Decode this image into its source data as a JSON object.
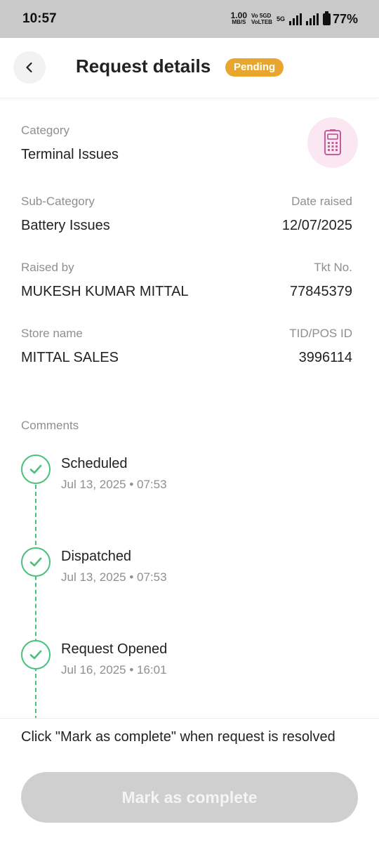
{
  "status_bar": {
    "time": "10:57",
    "net_speed_value": "1.00",
    "net_speed_unit": "MB/S",
    "volte_top": "Vo 5GD",
    "volte_bottom": "VoLTEB",
    "network_type": "5G",
    "battery": "77%"
  },
  "header": {
    "title": "Request details",
    "status": "Pending"
  },
  "details": {
    "category_label": "Category",
    "category_value": "Terminal Issues",
    "subcategory_label": "Sub-Category",
    "subcategory_value": "Battery Issues",
    "date_raised_label": "Date raised",
    "date_raised_value": "12/07/2025",
    "raised_by_label": "Raised by",
    "raised_by_value": "MUKESH KUMAR MITTAL",
    "ticket_label": "Tkt No.",
    "ticket_value": "77845379",
    "store_label": "Store name",
    "store_value": "MITTAL SALES",
    "tid_label": "TID/POS ID",
    "tid_value": "3996114"
  },
  "comments": {
    "label": "Comments",
    "items": [
      {
        "title": "Scheduled",
        "time": "Jul 13, 2025 • 07:53"
      },
      {
        "title": "Dispatched",
        "time": "Jul 13, 2025 • 07:53"
      },
      {
        "title": "Request Opened",
        "time": "Jul 16, 2025 • 16:01"
      }
    ]
  },
  "footer": {
    "note": "Click \"Mark as complete\" when request is resolved",
    "button_label": "Mark as complete"
  },
  "colors": {
    "badge": "#e8a72c",
    "timeline": "#49c07b",
    "icon_bg": "#fae7f1",
    "icon": "#c0609a",
    "button_disabled": "#cfcfcf"
  }
}
